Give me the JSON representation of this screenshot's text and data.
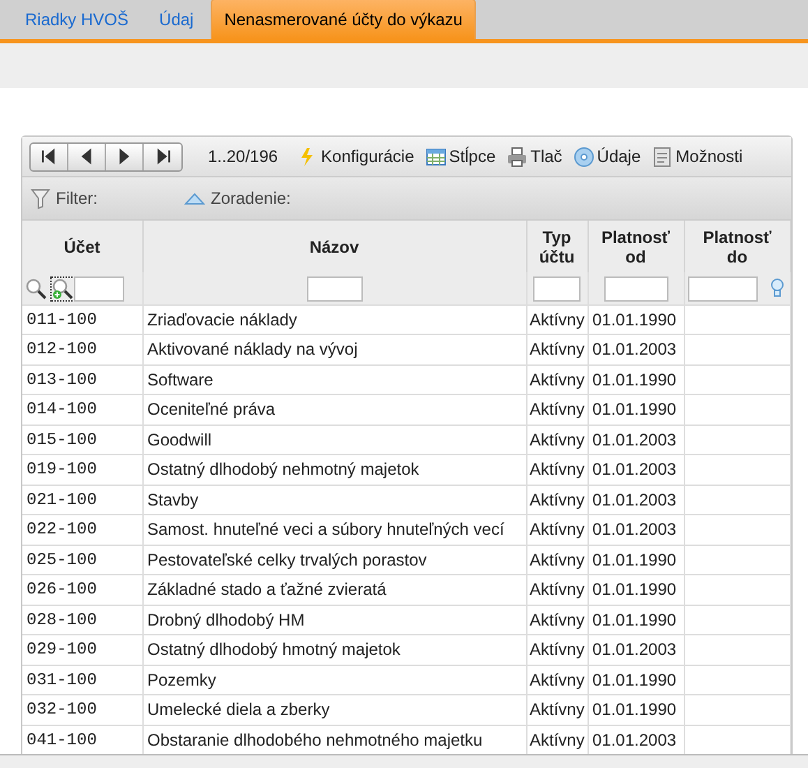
{
  "tabs": [
    {
      "label": "Riadky HVOŠ",
      "selected": false
    },
    {
      "label": "Údaj",
      "selected": false
    },
    {
      "label": "Nenasmerované účty do výkazu",
      "selected": true
    }
  ],
  "toolbar": {
    "pager_info": "1..20/196",
    "actions": [
      {
        "kind": "config",
        "label": "Konfigurácie"
      },
      {
        "kind": "columns",
        "label": "Stĺpce"
      },
      {
        "kind": "print",
        "label": "Tlač"
      },
      {
        "kind": "data",
        "label": "Údaje"
      },
      {
        "kind": "options",
        "label": "Možnosti"
      }
    ]
  },
  "filter_bar": {
    "filter_label": "Filter:",
    "sort_label": "Zoradenie:"
  },
  "table": {
    "columns": [
      "Účet",
      "Názov",
      "Typ účtu",
      "Platnosť od",
      "Platnosť do"
    ],
    "rows": [
      [
        "011-100",
        "Zriaďovacie náklady",
        "Aktívny",
        "01.01.1990",
        ""
      ],
      [
        "012-100",
        "Aktivované náklady na vývoj",
        "Aktívny",
        "01.01.2003",
        ""
      ],
      [
        "013-100",
        "Software",
        "Aktívny",
        "01.01.1990",
        ""
      ],
      [
        "014-100",
        "Oceniteľné práva",
        "Aktívny",
        "01.01.1990",
        ""
      ],
      [
        "015-100",
        "Goodwill",
        "Aktívny",
        "01.01.2003",
        ""
      ],
      [
        "019-100",
        "Ostatný dlhodobý nehmotný majetok",
        "Aktívny",
        "01.01.2003",
        ""
      ],
      [
        "021-100",
        "Stavby",
        "Aktívny",
        "01.01.2003",
        ""
      ],
      [
        "022-100",
        "Samost. hnuteľné veci a súbory hnuteľných vecí",
        "Aktívny",
        "01.01.2003",
        ""
      ],
      [
        "025-100",
        "Pestovateľské celky trvalých porastov",
        "Aktívny",
        "01.01.1990",
        ""
      ],
      [
        "026-100",
        "Základné stado a ťažné zvieratá",
        "Aktívny",
        "01.01.1990",
        ""
      ],
      [
        "028-100",
        "Drobný dlhodobý HM",
        "Aktívny",
        "01.01.1990",
        ""
      ],
      [
        "029-100",
        "Ostatný dlhodobý hmotný majetok",
        "Aktívny",
        "01.01.2003",
        ""
      ],
      [
        "031-100",
        "Pozemky",
        "Aktívny",
        "01.01.1990",
        ""
      ],
      [
        "032-100",
        "Umelecké diela a zberky",
        "Aktívny",
        "01.01.1990",
        ""
      ],
      [
        "041-100",
        "Obstaranie dlhodobého nehmotného majetku",
        "Aktívny",
        "01.01.2003",
        ""
      ]
    ]
  }
}
